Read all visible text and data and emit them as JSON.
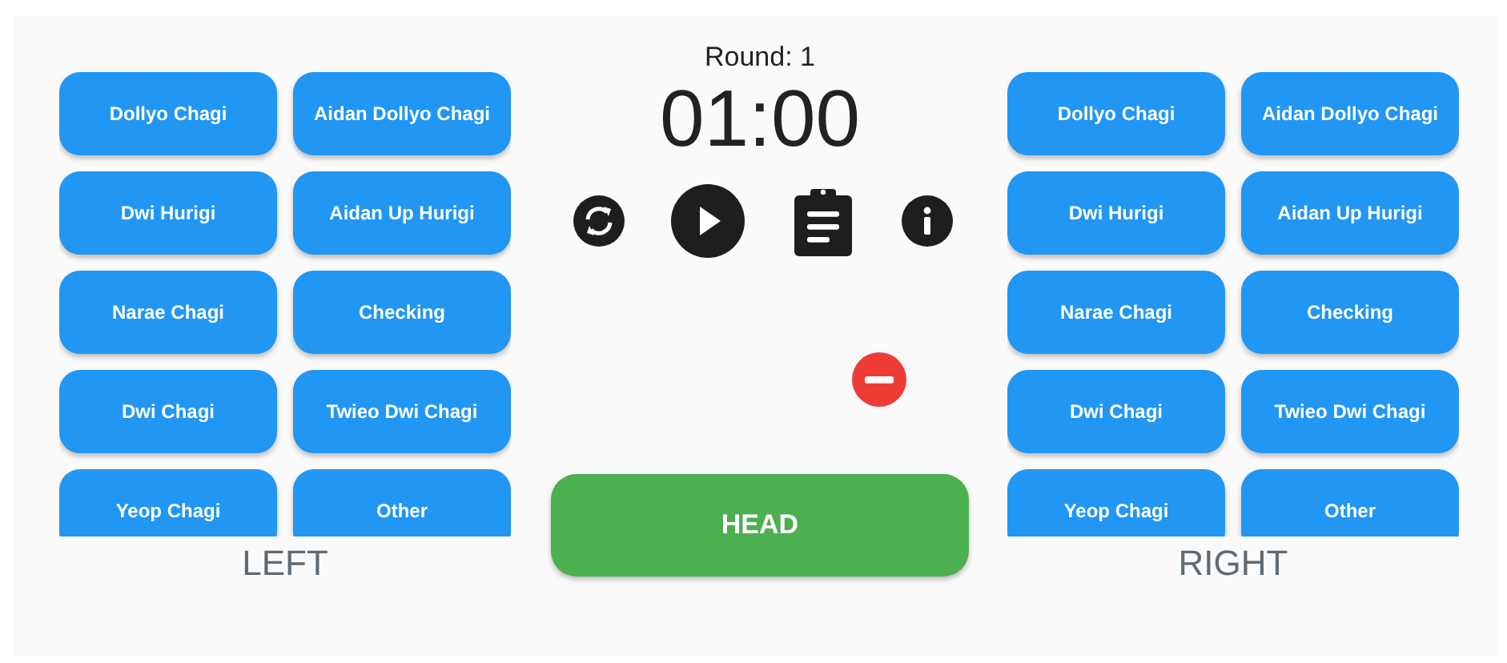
{
  "round_label": "Round: 1",
  "timer": "01:00",
  "sides": [
    {
      "label": "LEFT",
      "buttons": [
        "Dollyo Chagi",
        "Aidan Dollyo Chagi",
        "Dwi Hurigi",
        "Aidan Up Hurigi",
        "Narae Chagi",
        "Checking",
        "Dwi Chagi",
        "Twieo Dwi Chagi",
        "Yeop Chagi",
        "Other"
      ]
    },
    {
      "label": "RIGHT",
      "buttons": [
        "Dollyo Chagi",
        "Aidan Dollyo Chagi",
        "Dwi Hurigi",
        "Aidan Up Hurigi",
        "Narae Chagi",
        "Checking",
        "Dwi Chagi",
        "Twieo Dwi Chagi",
        "Yeop Chagi",
        "Other"
      ]
    }
  ],
  "target_button": "HEAD"
}
